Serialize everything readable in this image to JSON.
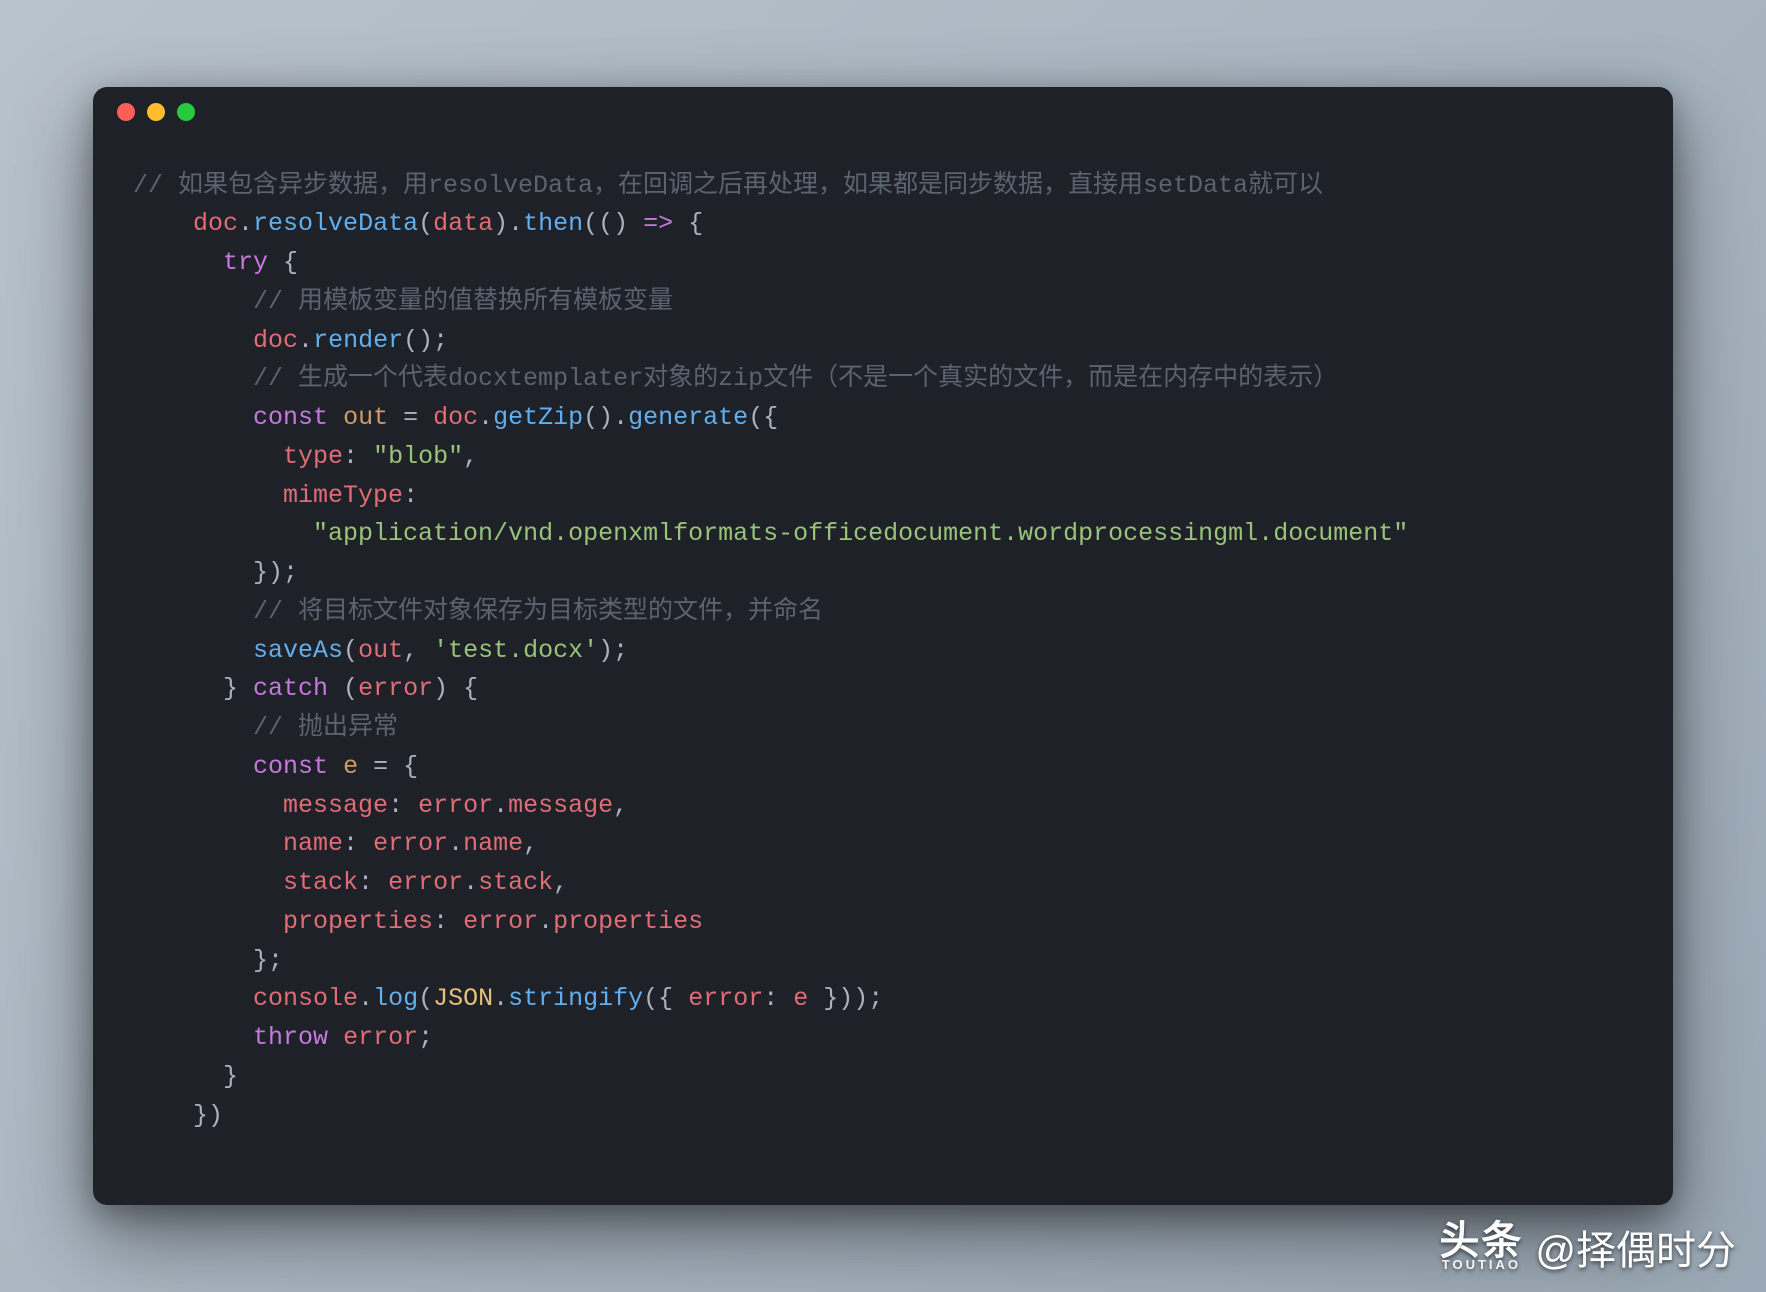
{
  "window": {
    "dots": [
      "red",
      "yellow",
      "green"
    ]
  },
  "code": {
    "line1_comment": "// 如果包含异步数据，用resolveData，在回调之后再处理，如果都是同步数据，直接用setData就可以",
    "doc": "doc",
    "resolveData": "resolveData",
    "data_param": "data",
    "then": "then",
    "arrow": "() => {",
    "try": "try",
    "open_brace": " {",
    "comment_replace": "// 用模板变量的值替换所有模板变量",
    "render": "render",
    "render_call": "();",
    "comment_zip": "// 生成一个代表docxtemplater对象的zip文件（不是一个真实的文件，而是在内存中的表示）",
    "const": "const",
    "out": "out",
    "eq": " = ",
    "getZip": "getZip",
    "generate": "generate",
    "open_obj": "({",
    "type_key": "type",
    "type_val": "\"blob\"",
    "mimeType_key": "mimeType",
    "mime_val": "\"application/vnd.openxmlformats-officedocument.wordprocessingml.document\"",
    "close_obj": "});",
    "comment_save": "// 将目标文件对象保存为目标类型的文件，并命名",
    "saveAs": "saveAs",
    "saveAs_args_open": "(",
    "out_arg": "out",
    "comma": ", ",
    "filename": "'test.docx'",
    "saveAs_close": ");",
    "catch": "catch",
    "error_param": "error",
    "catch_open": ") {",
    "comment_throw": "// 抛出异常",
    "e_var": "e",
    "e_open": " = {",
    "message_key": "message",
    "error_message": "error",
    "dot": ".",
    "message_prop": "message",
    "name_key": "name",
    "name_prop": "name",
    "stack_key": "stack",
    "stack_prop": "stack",
    "properties_key": "properties",
    "properties_prop": "properties",
    "e_close": "};",
    "console": "console",
    "log": "log",
    "JSON": "JSON",
    "stringify": "stringify",
    "error_key": "error",
    "e_ref": "e",
    "log_close": " }));",
    "throw": "throw",
    "error_throw": "error",
    "semi": ";",
    "close_brace": "}",
    "close_paren_brace": "})"
  },
  "watermark": {
    "logo_top": "头条",
    "logo_bot": "TOUTIAO",
    "handle": "@择偶时分"
  }
}
